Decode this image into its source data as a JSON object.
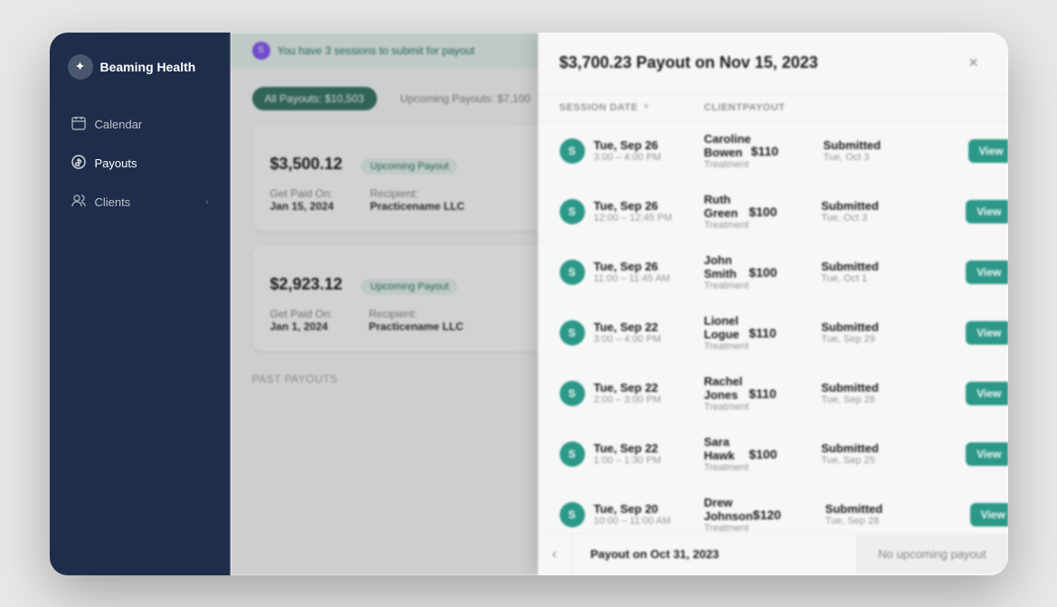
{
  "app": {
    "name": "Beaming Health"
  },
  "sidebar": {
    "items": [
      {
        "label": "Calendar",
        "icon": "calendar"
      },
      {
        "label": "Payouts",
        "icon": "dollar",
        "active": true
      },
      {
        "label": "Clients",
        "icon": "users"
      }
    ]
  },
  "main": {
    "banner": "You have 3 sessions to submit for payout",
    "tabs": [
      {
        "label": "All Payouts: $10,503",
        "active": true
      },
      {
        "label": "Upcoming Payouts: $7,100"
      }
    ],
    "payouts": [
      {
        "amount": "$3,500.",
        "cents": "12",
        "badge": "Upcoming Payout",
        "get_paid_on_label": "Get Paid On:",
        "get_paid_on_value": "Jan 15, 2024",
        "recipient_label": "Recipient:",
        "recipient_value": "Practicename LLC"
      },
      {
        "amount": "$2,923.",
        "cents": "12",
        "badge": "Upcoming Payout",
        "get_paid_on_label": "Get Paid On:",
        "get_paid_on_value": "Jan 1, 2024",
        "recipient_label": "Recipient:",
        "recipient_value": "Practicename LLC"
      }
    ],
    "past_payouts_label": "PAST PAYOUTS"
  },
  "modal": {
    "title": "$3,700.23 Payout on Nov 15, 2023",
    "close_label": "×",
    "table_headers": [
      {
        "label": "SESSION DATE",
        "sortable": true
      },
      {
        "label": "CLIENT"
      },
      {
        "label": "PAYOUT"
      },
      {
        "label": ""
      },
      {
        "label": ""
      }
    ],
    "sessions": [
      {
        "date": "Tue, Sep 26",
        "time": "3:00 – 4:00 PM",
        "client_name": "Caroline Bowen",
        "client_type": "Treatment",
        "payout": "$110",
        "status": "Submitted",
        "status_date": "Tue, Oct 3",
        "view_label": "View"
      },
      {
        "date": "Tue, Sep 26",
        "time": "12:00 – 12:45 PM",
        "client_name": "Ruth Green",
        "client_type": "Treatment",
        "payout": "$100",
        "status": "Submitted",
        "status_date": "Tue, Oct 3",
        "view_label": "View"
      },
      {
        "date": "Tue, Sep 26",
        "time": "11:00 – 11:45 AM",
        "client_name": "John Smith",
        "client_type": "Treatment",
        "payout": "$100",
        "status": "Submitted",
        "status_date": "Tue, Oct 1",
        "view_label": "View"
      },
      {
        "date": "Tue, Sep 22",
        "time": "3:00 – 4:00 PM",
        "client_name": "Lionel Logue",
        "client_type": "Treatment",
        "payout": "$110",
        "status": "Submitted",
        "status_date": "Tue, Sep 29",
        "view_label": "View"
      },
      {
        "date": "Tue, Sep 22",
        "time": "2:00 – 3:00 PM",
        "client_name": "Rachel Jones",
        "client_type": "Treatment",
        "payout": "$110",
        "status": "Submitted",
        "status_date": "Tue, Sep 28",
        "view_label": "View"
      },
      {
        "date": "Tue, Sep 22",
        "time": "1:00 – 1:30 PM",
        "client_name": "Sara Hawk",
        "client_type": "Treatment",
        "payout": "$100",
        "status": "Submitted",
        "status_date": "Tue, Sep 25",
        "view_label": "View"
      },
      {
        "date": "Tue, Sep 20",
        "time": "10:00 – 11:00 AM",
        "client_name": "Drew Johnson",
        "client_type": "Treatment",
        "payout": "$120",
        "status": "Submitted",
        "status_date": "Tue, Sep 28",
        "view_label": "View"
      }
    ],
    "footer": {
      "prev_icon": "‹",
      "payout_label": "Payout on Oct 31, 2023",
      "no_upcoming": "No upcoming payout"
    }
  }
}
